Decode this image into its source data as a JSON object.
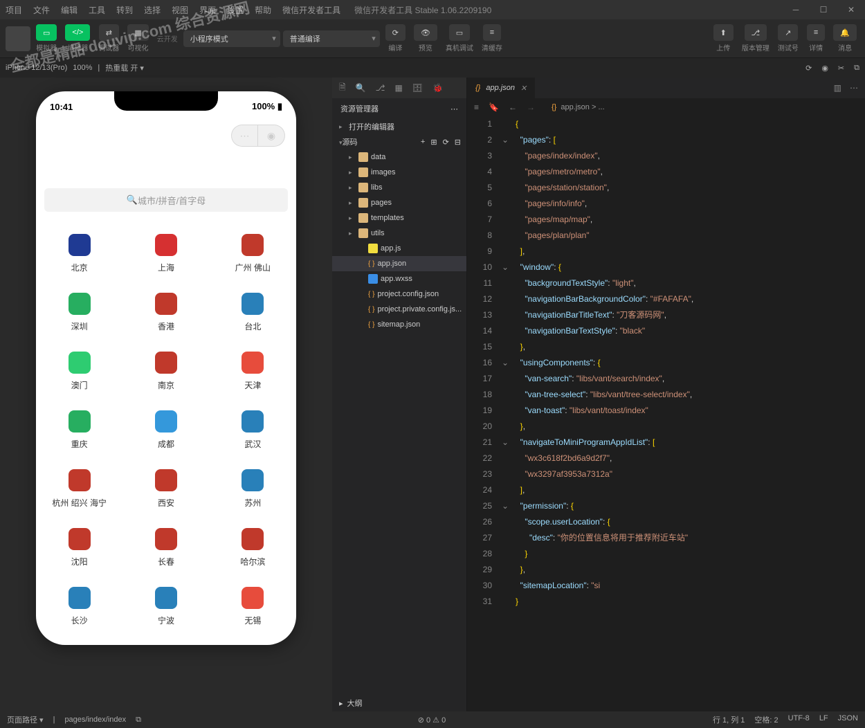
{
  "window": {
    "title": "微信开发者工具 Stable 1.06.2209190",
    "menu": [
      "项目",
      "文件",
      "编辑",
      "工具",
      "转到",
      "选择",
      "视图",
      "界面",
      "设置",
      "帮助",
      "微信开发者工具"
    ]
  },
  "toolbar": {
    "simulator": "模拟器",
    "editor_btn": "编辑器",
    "debugger": "调试器",
    "visual": "可视化",
    "cloud": "云开发",
    "mode": "小程序模式",
    "compile_mode": "普通编译",
    "compile": "编译",
    "preview": "预览",
    "realdev": "真机调试",
    "clear": "清缓存",
    "upload": "上传",
    "version": "版本管理",
    "testno": "测试号",
    "detail": "详情",
    "message": "消息"
  },
  "devbar": {
    "device": "iPhone 12/13(Pro)",
    "zoom": "100%",
    "hot": "热重载 开 ▾"
  },
  "phone": {
    "time": "10:41",
    "battery": "100%",
    "search_placeholder": "城市/拼音/首字母",
    "cities": [
      {
        "name": "北京",
        "color": "#1f3a93"
      },
      {
        "name": "上海",
        "color": "#d63031"
      },
      {
        "name": "广州 佛山",
        "color": "#c0392b"
      },
      {
        "name": "深圳",
        "color": "#27ae60"
      },
      {
        "name": "香港",
        "color": "#c0392b"
      },
      {
        "name": "台北",
        "color": "#2980b9"
      },
      {
        "name": "澳门",
        "color": "#2ecc71"
      },
      {
        "name": "南京",
        "color": "#c0392b"
      },
      {
        "name": "天津",
        "color": "#e74c3c"
      },
      {
        "name": "重庆",
        "color": "#27ae60"
      },
      {
        "name": "成都",
        "color": "#3498db"
      },
      {
        "name": "武汉",
        "color": "#2980b9"
      },
      {
        "name": "杭州 绍兴 海宁",
        "color": "#c0392b"
      },
      {
        "name": "西安",
        "color": "#c0392b"
      },
      {
        "name": "苏州",
        "color": "#2980b9"
      },
      {
        "name": "沈阳",
        "color": "#c0392b"
      },
      {
        "name": "长春",
        "color": "#c0392b"
      },
      {
        "name": "哈尔滨",
        "color": "#c0392b"
      },
      {
        "name": "长沙",
        "color": "#2980b9"
      },
      {
        "name": "宁波",
        "color": "#2980b9"
      },
      {
        "name": "无锡",
        "color": "#e74c3c"
      }
    ]
  },
  "explorer": {
    "title": "资源管理器",
    "open_editors": "打开的编辑器",
    "source": "源码",
    "tree": [
      {
        "label": "data",
        "type": "folder",
        "indent": 1
      },
      {
        "label": "images",
        "type": "folder",
        "indent": 1
      },
      {
        "label": "libs",
        "type": "folder",
        "indent": 1
      },
      {
        "label": "pages",
        "type": "folder",
        "indent": 1
      },
      {
        "label": "templates",
        "type": "folder",
        "indent": 1
      },
      {
        "label": "utils",
        "type": "folder",
        "indent": 1
      },
      {
        "label": "app.js",
        "type": "js",
        "indent": 2
      },
      {
        "label": "app.json",
        "type": "json",
        "indent": 2,
        "sel": true
      },
      {
        "label": "app.wxss",
        "type": "css",
        "indent": 2
      },
      {
        "label": "project.config.json",
        "type": "json",
        "indent": 2
      },
      {
        "label": "project.private.config.js...",
        "type": "json",
        "indent": 2
      },
      {
        "label": "sitemap.json",
        "type": "json",
        "indent": 2
      }
    ],
    "outline": "大纲"
  },
  "editor": {
    "tab": "app.json",
    "breadcrumb": "app.json > ...",
    "lines": [
      {
        "n": 1,
        "html": "<span class='s-br'>{</span>"
      },
      {
        "n": 2,
        "fold": true,
        "html": "  <span class='s-key'>\"pages\"</span>: <span class='s-br'>[</span>"
      },
      {
        "n": 3,
        "html": "    <span class='s-str'>\"pages/index/index\"</span>,"
      },
      {
        "n": 4,
        "html": "    <span class='s-str'>\"pages/metro/metro\"</span>,"
      },
      {
        "n": 5,
        "html": "    <span class='s-str'>\"pages/station/station\"</span>,"
      },
      {
        "n": 6,
        "html": "    <span class='s-str'>\"pages/info/info\"</span>,"
      },
      {
        "n": 7,
        "html": "    <span class='s-str'>\"pages/map/map\"</span>,"
      },
      {
        "n": 8,
        "html": "    <span class='s-str'>\"pages/plan/plan\"</span>"
      },
      {
        "n": 9,
        "html": "  <span class='s-br'>]</span>,"
      },
      {
        "n": 10,
        "fold": true,
        "html": "  <span class='s-key'>\"window\"</span>: <span class='s-br'>{</span>"
      },
      {
        "n": 11,
        "html": "    <span class='s-key'>\"backgroundTextStyle\"</span>: <span class='s-str'>\"light\"</span>,"
      },
      {
        "n": 12,
        "html": "    <span class='s-key'>\"navigationBarBackgroundColor\"</span>: <span class='s-str'>\"#FAFAFA\"</span>,"
      },
      {
        "n": 13,
        "html": "    <span class='s-key'>\"navigationBarTitleText\"</span>: <span class='s-str'>\"刀客源码网\"</span>,"
      },
      {
        "n": 14,
        "html": "    <span class='s-key'>\"navigationBarTextStyle\"</span>: <span class='s-str'>\"black\"</span>"
      },
      {
        "n": 15,
        "html": "  <span class='s-br'>}</span>,"
      },
      {
        "n": 16,
        "fold": true,
        "html": "  <span class='s-key'>\"usingComponents\"</span>: <span class='s-br'>{</span>"
      },
      {
        "n": 17,
        "html": "    <span class='s-key'>\"van-search\"</span>: <span class='s-str'>\"libs/vant/search/index\"</span>,"
      },
      {
        "n": 18,
        "html": "    <span class='s-key'>\"van-tree-select\"</span>: <span class='s-str'>\"libs/vant/tree-select/index\"</span>,"
      },
      {
        "n": 19,
        "html": "    <span class='s-key'>\"van-toast\"</span>: <span class='s-str'>\"libs/vant/toast/index\"</span>"
      },
      {
        "n": 20,
        "html": "  <span class='s-br'>}</span>,"
      },
      {
        "n": 21,
        "fold": true,
        "html": "  <span class='s-key'>\"navigateToMiniProgramAppIdList\"</span>: <span class='s-br'>[</span>"
      },
      {
        "n": 22,
        "html": "    <span class='s-str'>\"wx3c618f2bd6a9d2f7\"</span>,"
      },
      {
        "n": 23,
        "html": "    <span class='s-str'>\"wx3297af3953a7312a\"</span>"
      },
      {
        "n": 24,
        "html": "  <span class='s-br'>]</span>,"
      },
      {
        "n": 25,
        "fold": true,
        "html": "  <span class='s-key'>\"permission\"</span>: <span class='s-br'>{</span>"
      },
      {
        "n": 26,
        "html": "    <span class='s-key'>\"scope.userLocation\"</span>: <span class='s-br'>{</span>"
      },
      {
        "n": 27,
        "html": "      <span class='s-key'>\"desc\"</span>: <span class='s-str'>\"你的位置信息将用于推荐附近车站\"</span>"
      },
      {
        "n": 28,
        "html": "    <span class='s-br'>}</span>"
      },
      {
        "n": 29,
        "html": "  <span class='s-br'>}</span>,"
      },
      {
        "n": 30,
        "html": "  <span class='s-key'>\"sitemapLocation\"</span>: <span class='s-str'>\"si</span>"
      },
      {
        "n": 31,
        "html": "<span class='s-br'>}</span>"
      }
    ]
  },
  "status": {
    "path_label": "页面路径 ▾",
    "path": "pages/index/index",
    "errors": "⊘ 0 ⚠ 0",
    "line": "行 1, 列 1",
    "indent": "空格: 2",
    "enc": "UTF-8",
    "eol": "LF",
    "lang": "JSON"
  },
  "watermark": "全都是精品\n douvip.com\n综合资源网"
}
